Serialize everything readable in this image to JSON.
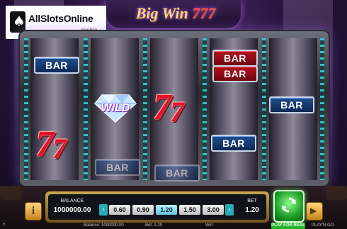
{
  "logo": {
    "name": "AllSlotsOnline",
    "sub": ".casino"
  },
  "game": {
    "title_main": "Big Win",
    "title_sevens": "777"
  },
  "reels": {
    "bar_label": "BAR",
    "wild_label": "WILD",
    "seven_glyph": "7"
  },
  "panel": {
    "balance_label": "BALANCE",
    "balance_value": "1000000.00",
    "bet_options": [
      "0.60",
      "0.90",
      "1.20",
      "1.50",
      "3.00"
    ],
    "selected_bet": "1.20",
    "bet_label": "BET",
    "bet_value": "1.20",
    "info_glyph": "i",
    "autoplay_glyph": "▶",
    "play_for_real": "PLAY FOR REAL",
    "arrow_left": "‹",
    "arrow_right": "›"
  },
  "status_bar": {
    "help": "?",
    "balance": "Balance: 1000000.00",
    "bet": "Bet: 1.20",
    "win": "Win:",
    "brand": "PLAY'N GO"
  },
  "colors": {
    "accent_cyan": "#39d2d6",
    "spin_green": "#1d9e27",
    "bar_blue": "#1f4e8e",
    "bar_red": "#b4121d",
    "seven_red": "#e3142a"
  }
}
